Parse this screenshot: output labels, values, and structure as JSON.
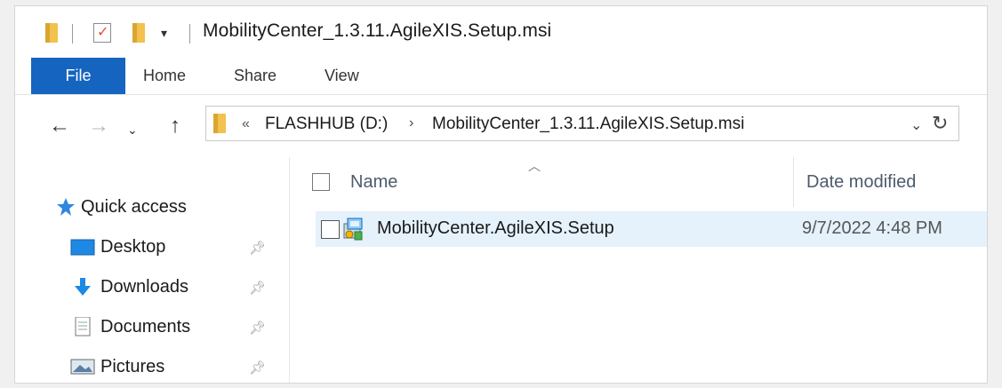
{
  "window": {
    "title": "MobilityCenter_1.3.11.AgileXIS.Setup.msi"
  },
  "quick_access_toolbar": {
    "icons": [
      "folder-icon",
      "properties-icon",
      "new-folder-icon",
      "customize-dropdown-icon"
    ]
  },
  "ribbon": {
    "tabs": [
      {
        "label": "File",
        "active": true
      },
      {
        "label": "Home"
      },
      {
        "label": "Share"
      },
      {
        "label": "View"
      }
    ],
    "accent_color": "#1565c0"
  },
  "address_bar": {
    "overflow_marker": "«",
    "breadcrumbs": [
      "FLASHHUB (D:)",
      "MobilityCenter_1.3.11.AgileXIS.Setup.msi"
    ]
  },
  "navigation": {
    "quick_access": "Quick access",
    "items": [
      {
        "label": "Desktop",
        "icon": "desktop-icon",
        "pinned": true
      },
      {
        "label": "Downloads",
        "icon": "download-icon",
        "pinned": true
      },
      {
        "label": "Documents",
        "icon": "document-icon",
        "pinned": true
      },
      {
        "label": "Pictures",
        "icon": "picture-icon",
        "pinned": true
      }
    ]
  },
  "file_list": {
    "columns": [
      "Name",
      "Date modified"
    ],
    "rows": [
      {
        "name": "MobilityCenter.AgileXIS.Setup",
        "date_modified": "9/7/2022 4:48 PM",
        "icon": "msi-installer-icon",
        "selected": true
      }
    ]
  }
}
